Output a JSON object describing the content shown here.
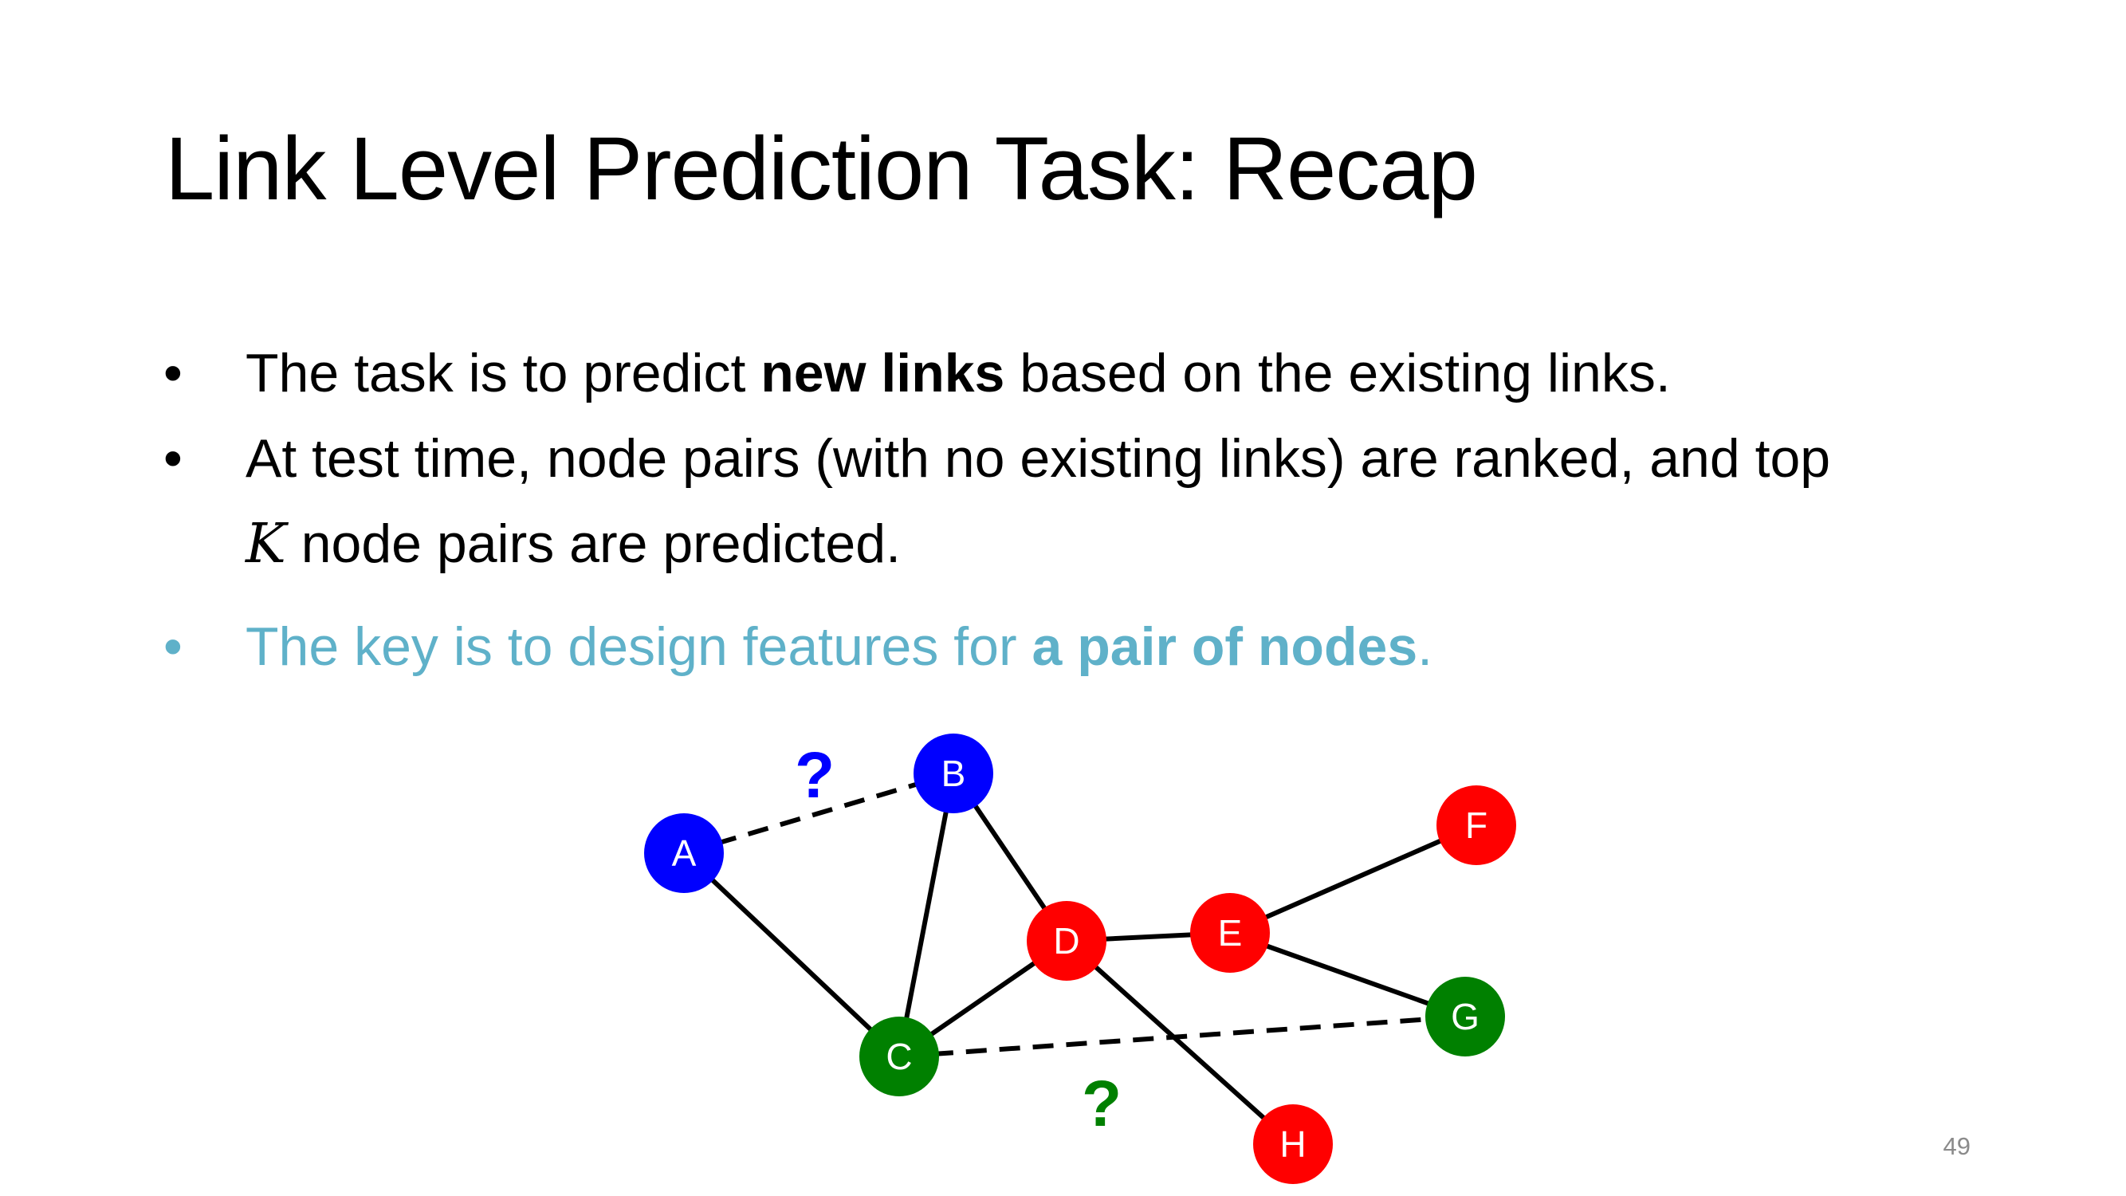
{
  "slide": {
    "title": "Link Level Prediction Task: Recap",
    "page_number": "49"
  },
  "bullets": [
    {
      "marker": "•",
      "before": "The task is to predict ",
      "bold": "new links",
      "after": " based on the  existing links."
    },
    {
      "marker": "•",
      "line1": "At test time, node pairs (with no existing links)  are ranked, and top",
      "math": "K",
      "line2": " node pairs are predicted."
    },
    {
      "marker": "•",
      "before": "The key is to design features for ",
      "bold": "a pair of nodes",
      "after": "."
    }
  ],
  "colors": {
    "text": "#000000",
    "accent": "#5fb1c9",
    "node_blue": "#0000ff",
    "node_red": "#ff0000",
    "node_green": "#008000",
    "edge": "#000000",
    "page_number": "#8b8b8b"
  },
  "graph": {
    "nodes": [
      {
        "id": "A",
        "label": "A",
        "color": "#0000ff"
      },
      {
        "id": "B",
        "label": "B",
        "color": "#0000ff"
      },
      {
        "id": "C",
        "label": "C",
        "color": "#008000"
      },
      {
        "id": "D",
        "label": "D",
        "color": "#ff0000"
      },
      {
        "id": "E",
        "label": "E",
        "color": "#ff0000"
      },
      {
        "id": "F",
        "label": "F",
        "color": "#ff0000"
      },
      {
        "id": "G",
        "label": "G",
        "color": "#008000"
      },
      {
        "id": "H",
        "label": "H",
        "color": "#ff0000"
      }
    ],
    "edges": [
      {
        "from": "A",
        "to": "C",
        "style": "solid"
      },
      {
        "from": "B",
        "to": "C",
        "style": "solid"
      },
      {
        "from": "B",
        "to": "D",
        "style": "solid"
      },
      {
        "from": "C",
        "to": "D",
        "style": "solid"
      },
      {
        "from": "D",
        "to": "E",
        "style": "solid"
      },
      {
        "from": "E",
        "to": "F",
        "style": "solid"
      },
      {
        "from": "E",
        "to": "G",
        "style": "solid"
      },
      {
        "from": "D",
        "to": "H",
        "style": "solid"
      },
      {
        "from": "A",
        "to": "B",
        "style": "dashed"
      },
      {
        "from": "C",
        "to": "G",
        "style": "dashed"
      }
    ],
    "question_marks": [
      {
        "text": "?",
        "color": "#0000ff",
        "near_edge": "A-B"
      },
      {
        "text": "?",
        "color": "#008000",
        "near_edge": "C-G"
      }
    ]
  }
}
